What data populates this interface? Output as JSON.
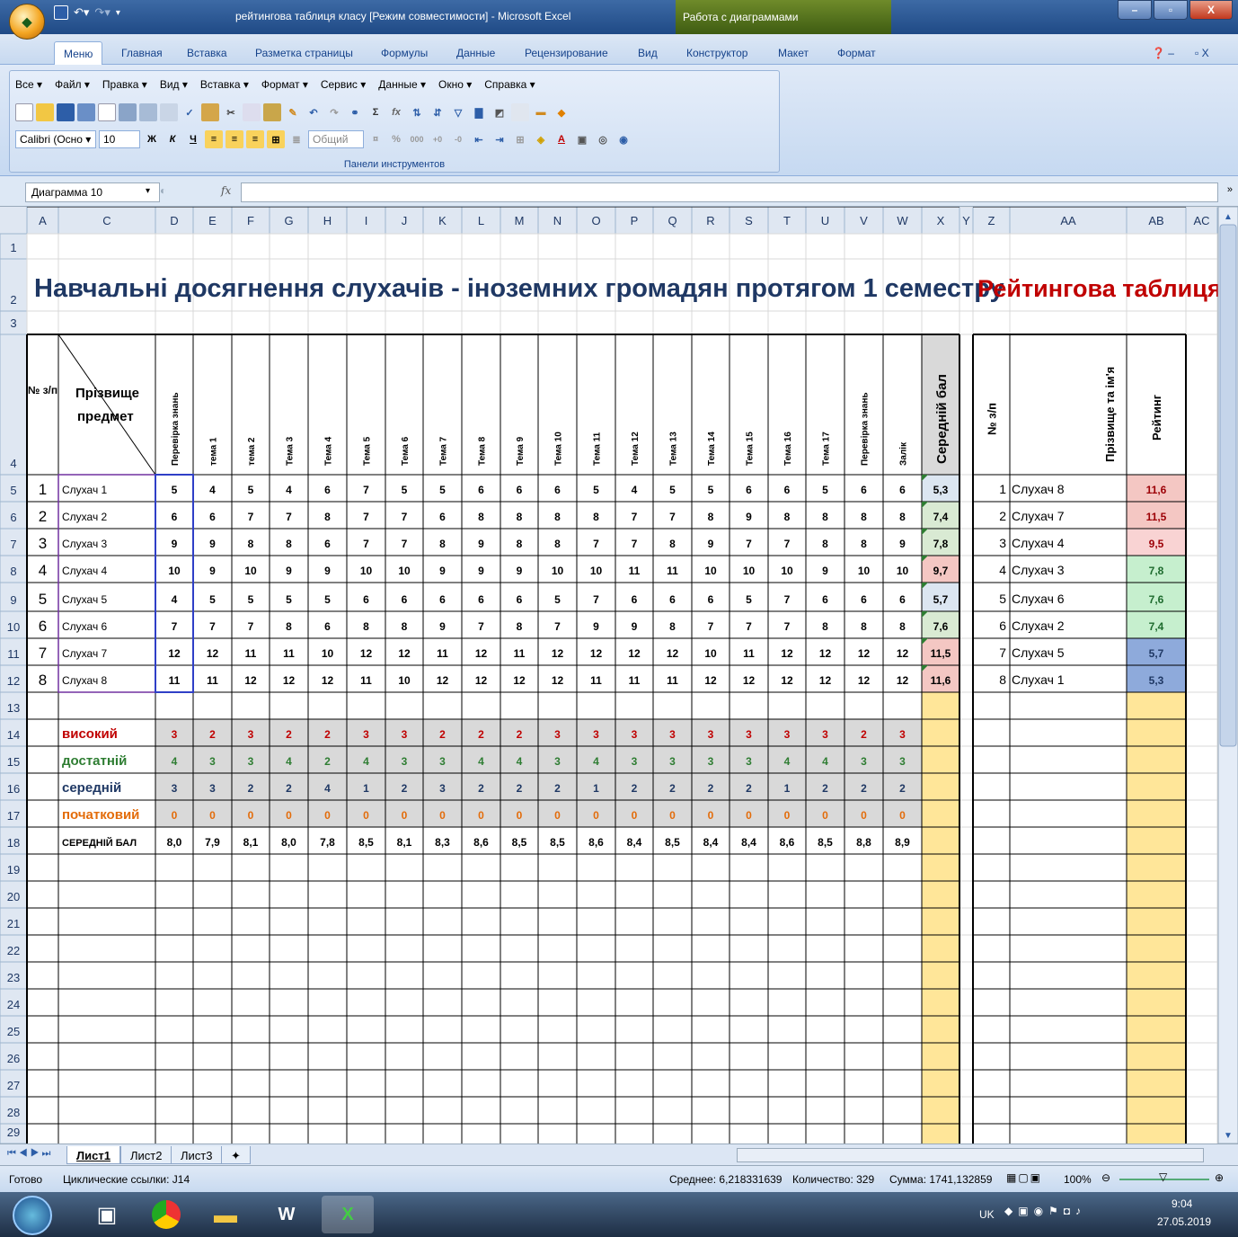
{
  "window": {
    "title": "рейтингова таблиця класу  [Режим совместимости] - Microsoft Excel",
    "context_group": "Работа с диаграммами",
    "office_button": "Office"
  },
  "ribbon_tabs": [
    "Меню",
    "Главная",
    "Вставка",
    "Разметка страницы",
    "Формулы",
    "Данные",
    "Рецензирование",
    "Вид",
    "Конструктор",
    "Макет",
    "Формат"
  ],
  "menu_items": [
    "Все ▾",
    "Файл ▾",
    "Правка ▾",
    "Вид ▾",
    "Вставка ▾",
    "Формат ▾",
    "Сервис ▾",
    "Данные ▾",
    "Окно ▾",
    "Справка ▾"
  ],
  "toolbar": {
    "font_name": "Calibri (Осно ▾",
    "font_size": "10",
    "number_format": "Общий",
    "bold": "Ж",
    "italic": "К",
    "underline": "Ч",
    "group_label": "Панели инструментов"
  },
  "formula_bar": {
    "name_box": "Диаграмма 10",
    "fx": "fx",
    "value": ""
  },
  "columns": [
    "A",
    "C",
    "D",
    "E",
    "F",
    "G",
    "H",
    "I",
    "J",
    "K",
    "L",
    "M",
    "N",
    "O",
    "P",
    "Q",
    "R",
    "S",
    "T",
    "U",
    "V",
    "W",
    "X",
    "Y",
    "Z",
    "AA",
    "AB",
    "AC"
  ],
  "row_numbers": [
    "1",
    "2",
    "3",
    "4",
    "5",
    "6",
    "7",
    "8",
    "9",
    "10",
    "11",
    "12",
    "13",
    "14",
    "15",
    "16",
    "17",
    "18",
    "19",
    "20",
    "21",
    "22",
    "23",
    "24",
    "25",
    "26",
    "27",
    "28",
    "29"
  ],
  "sheet": {
    "main_title": "Навчальні досягнення слухачів - іноземних громадян протягом 1 семестру",
    "rating_title": "Рейтингова таблиця",
    "num_header": "№ з/п",
    "name_header_top": "Прізвище",
    "name_header_bottom": "предмет",
    "topic_headers": [
      "Перевірка знань",
      "тема 1",
      "тема 2",
      "Тема 3",
      "Тема 4",
      "Тема 5",
      "Тема 6",
      "Тема 7",
      "Тема 8",
      "Тема 9",
      "Тема 10",
      "Тема 11",
      "Тема 12",
      "Тема 13",
      "Тема 14",
      "Тема 15",
      "Тема 16",
      "Тема 17",
      "Перевірка знань",
      "Залік"
    ],
    "avg_header": "Середній бал",
    "students": [
      {
        "n": "1",
        "name": "Слухач 1",
        "scores": [
          "5",
          "4",
          "5",
          "4",
          "6",
          "7",
          "5",
          "5",
          "6",
          "6",
          "6",
          "5",
          "4",
          "5",
          "5",
          "6",
          "6",
          "5",
          "6",
          "6"
        ],
        "avg": "5,3"
      },
      {
        "n": "2",
        "name": "Слухач 2",
        "scores": [
          "6",
          "6",
          "7",
          "7",
          "8",
          "7",
          "7",
          "6",
          "8",
          "8",
          "8",
          "8",
          "7",
          "7",
          "8",
          "9",
          "8",
          "8",
          "8",
          "8"
        ],
        "avg": "7,4"
      },
      {
        "n": "3",
        "name": "Слухач 3",
        "scores": [
          "9",
          "9",
          "8",
          "8",
          "6",
          "7",
          "7",
          "8",
          "9",
          "8",
          "8",
          "7",
          "7",
          "8",
          "9",
          "7",
          "7",
          "8",
          "8",
          "9"
        ],
        "avg": "7,8"
      },
      {
        "n": "4",
        "name": "Слухач 4",
        "scores": [
          "10",
          "9",
          "10",
          "9",
          "9",
          "10",
          "10",
          "9",
          "9",
          "9",
          "10",
          "10",
          "11",
          "11",
          "10",
          "10",
          "10",
          "9",
          "10",
          "10"
        ],
        "avg": "9,7"
      },
      {
        "n": "5",
        "name": "Слухач 5",
        "scores": [
          "4",
          "5",
          "5",
          "5",
          "5",
          "6",
          "6",
          "6",
          "6",
          "6",
          "5",
          "7",
          "6",
          "6",
          "6",
          "5",
          "7",
          "6",
          "6",
          "6"
        ],
        "avg": "5,7"
      },
      {
        "n": "6",
        "name": "Слухач 6",
        "scores": [
          "7",
          "7",
          "7",
          "8",
          "6",
          "8",
          "8",
          "9",
          "7",
          "8",
          "7",
          "9",
          "9",
          "8",
          "7",
          "7",
          "7",
          "8",
          "8",
          "8"
        ],
        "avg": "7,6"
      },
      {
        "n": "7",
        "name": "Слухач 7",
        "scores": [
          "12",
          "12",
          "11",
          "11",
          "10",
          "12",
          "12",
          "11",
          "12",
          "11",
          "12",
          "12",
          "12",
          "12",
          "10",
          "11",
          "12",
          "12",
          "12",
          "12"
        ],
        "avg": "11,5"
      },
      {
        "n": "8",
        "name": "Слухач 8",
        "scores": [
          "11",
          "11",
          "12",
          "12",
          "12",
          "11",
          "10",
          "12",
          "12",
          "12",
          "12",
          "11",
          "11",
          "11",
          "12",
          "12",
          "12",
          "12",
          "12",
          "12"
        ],
        "avg": "11,6"
      }
    ],
    "levels": [
      {
        "label": "високий",
        "color": "#c00000",
        "values": [
          "3",
          "2",
          "3",
          "2",
          "2",
          "3",
          "3",
          "2",
          "2",
          "2",
          "3",
          "3",
          "3",
          "3",
          "3",
          "3",
          "3",
          "3",
          "2",
          "3"
        ]
      },
      {
        "label": "достатній",
        "color": "#2e7d32",
        "values": [
          "4",
          "3",
          "3",
          "4",
          "2",
          "4",
          "3",
          "3",
          "4",
          "4",
          "3",
          "4",
          "3",
          "3",
          "3",
          "3",
          "4",
          "4",
          "3",
          "3"
        ]
      },
      {
        "label": "середній",
        "color": "#1f3864",
        "values": [
          "3",
          "3",
          "2",
          "2",
          "4",
          "1",
          "2",
          "3",
          "2",
          "2",
          "2",
          "1",
          "2",
          "2",
          "2",
          "2",
          "1",
          "2",
          "2",
          "2"
        ]
      },
      {
        "label": "початковий",
        "color": "#e36c0a",
        "values": [
          "0",
          "0",
          "0",
          "0",
          "0",
          "0",
          "0",
          "0",
          "0",
          "0",
          "0",
          "0",
          "0",
          "0",
          "0",
          "0",
          "0",
          "0",
          "0",
          "0"
        ]
      }
    ],
    "avg_row": {
      "label": "СЕРЕДНІЙ БАЛ",
      "values": [
        "8,0",
        "7,9",
        "8,1",
        "8,0",
        "7,8",
        "8,5",
        "8,1",
        "8,3",
        "8,6",
        "8,5",
        "8,5",
        "8,6",
        "8,4",
        "8,5",
        "8,4",
        "8,4",
        "8,6",
        "8,5",
        "8,8",
        "8,9"
      ]
    },
    "rating_headers": {
      "num": "№ з/п",
      "name": "Прізвище та ім'я",
      "rating": "Рейтинг"
    },
    "rating": [
      {
        "n": "1",
        "name": "Слухач 8",
        "score": "11,6",
        "fill": "#f4c7c3"
      },
      {
        "n": "2",
        "name": "Слухач 7",
        "score": "11,5",
        "fill": "#f4c7c3"
      },
      {
        "n": "3",
        "name": "Слухач 4",
        "score": "9,5",
        "fill": "#f9d3d3"
      },
      {
        "n": "4",
        "name": "Слухач 3",
        "score": "7,8",
        "fill": "#c6efce"
      },
      {
        "n": "5",
        "name": "Слухач 6",
        "score": "7,6",
        "fill": "#c6efce"
      },
      {
        "n": "6",
        "name": "Слухач 2",
        "score": "7,4",
        "fill": "#c6efce"
      },
      {
        "n": "7",
        "name": "Слухач 5",
        "score": "5,7",
        "fill": "#8eaadb"
      },
      {
        "n": "8",
        "name": "Слухач 1",
        "score": "5,3",
        "fill": "#8eaadb"
      }
    ]
  },
  "sheet_tabs": [
    "Лист1",
    "Лист2",
    "Лист3"
  ],
  "status": {
    "ready": "Готово",
    "circular": "Циклические ссылки: J14",
    "average": "Среднее: 6,218331639",
    "count": "Количество: 329",
    "sum": "Сумма: 1741,132859",
    "zoom": "100%"
  },
  "taskbar": {
    "lang": "UK",
    "time": "9:04",
    "date": "27.05.2019"
  },
  "colors": {
    "avg_fill_high": "#f4c7c3",
    "avg_fill_mid": "#d9ead3",
    "avg_fill_low": "#dce6f1",
    "level_fill": "#d9d9d9",
    "empty_avg_fill": "#ffe699"
  }
}
